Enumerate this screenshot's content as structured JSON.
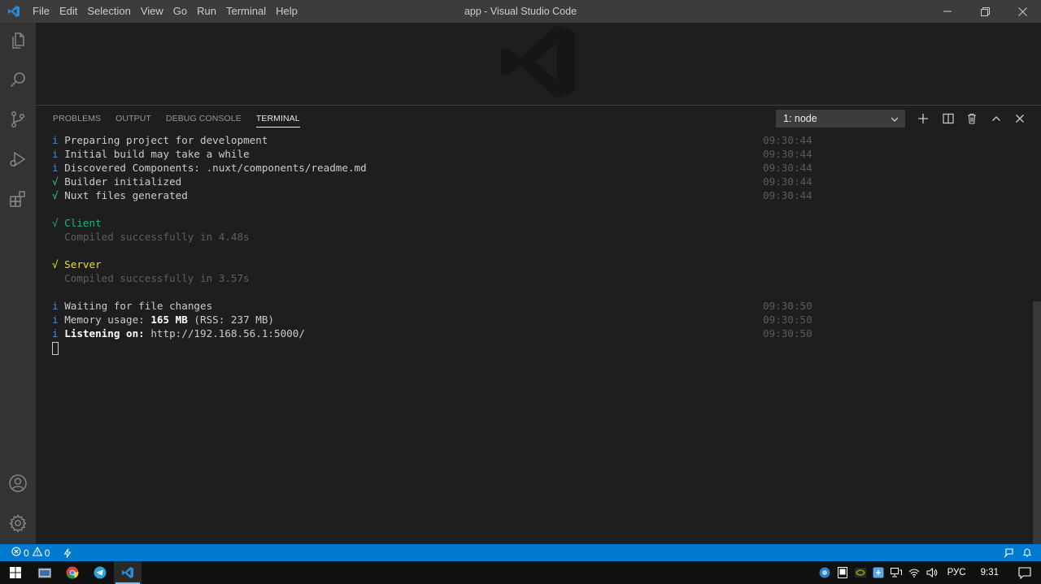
{
  "window": {
    "title": "app - Visual Studio Code",
    "menu": [
      "File",
      "Edit",
      "Selection",
      "View",
      "Go",
      "Run",
      "Terminal",
      "Help"
    ]
  },
  "activity_bar": {
    "icons": [
      "explorer-icon",
      "search-icon",
      "source-control-icon",
      "run-debug-icon",
      "extensions-icon",
      "account-icon",
      "manage-gear-icon"
    ]
  },
  "panel": {
    "tabs": [
      "PROBLEMS",
      "OUTPUT",
      "DEBUG CONSOLE",
      "TERMINAL"
    ],
    "active_tab": "TERMINAL",
    "terminal_select": "1: node",
    "actions": [
      "new-terminal-icon",
      "split-terminal-icon",
      "kill-terminal-icon",
      "maximize-panel-icon",
      "close-panel-icon"
    ]
  },
  "terminal": {
    "lines": [
      {
        "prefix": "i",
        "text": "Preparing project for development",
        "time": "09:30:44"
      },
      {
        "prefix": "i",
        "text": "Initial build may take a while",
        "time": "09:30:44"
      },
      {
        "prefix": "i",
        "text": "Discovered Components: .nuxt/components/readme.md",
        "time": "09:30:44"
      },
      {
        "prefix": "√",
        "text": "Builder initialized",
        "time": "09:30:44"
      },
      {
        "prefix": "√",
        "text": "Nuxt files generated",
        "time": "09:30:44"
      },
      {
        "client_title": "√ Client",
        "client_sub": "  Compiled successfully in 4.48s"
      },
      {
        "server_title": "√ Server",
        "server_sub": "  Compiled successfully in 3.57s"
      },
      {
        "prefix": "i",
        "text": "Waiting for file changes",
        "time": "09:30:50"
      },
      {
        "prefix": "i",
        "text_a": "Memory usage: ",
        "bold": "165 MB",
        "text_b": " (RSS: 237 MB)",
        "time": "09:30:50"
      },
      {
        "prefix": "i",
        "bold": "Listening on:",
        "text_b": " http://192.168.56.1:5000/",
        "time": "09:30:50"
      }
    ]
  },
  "status_bar": {
    "errors": "0",
    "warnings": "0"
  },
  "taskbar": {
    "apps": [
      "windows-start-icon",
      "file-explorer-icon",
      "chrome-icon",
      "telegram-icon",
      "vscode-icon"
    ],
    "language": "РУС",
    "time": "9:31"
  },
  "colors": {
    "status_bar": "#007acc",
    "activity_bar": "#333333",
    "title_bar": "#3c3c3c",
    "editor_bg": "#1e1e1e"
  }
}
